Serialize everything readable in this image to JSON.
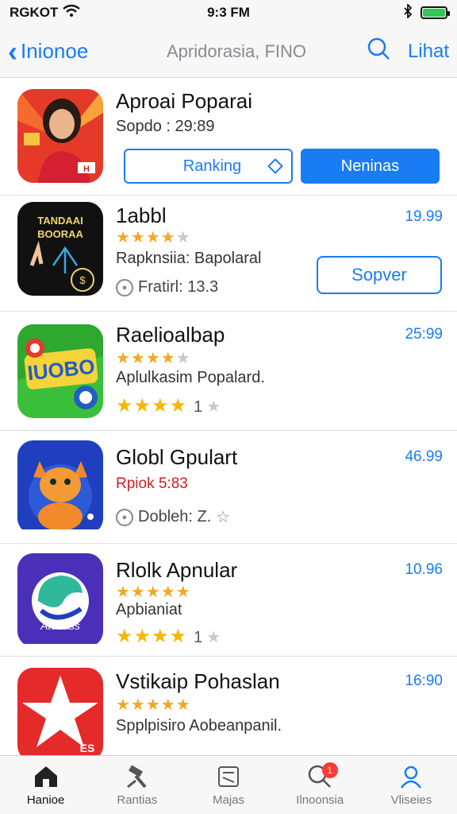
{
  "status_bar": {
    "carrier": "RGKOT",
    "time": "9:3 FM"
  },
  "nav": {
    "back_label": "Inionoe",
    "title": "Apridorasia, FINO",
    "right_label": "Lihat"
  },
  "featured": {
    "title": "Aproai Poparai",
    "subtitle": "Sopdo : 29:89",
    "button_ranking": "Ranking",
    "button_primary": "Neninas"
  },
  "apps": [
    {
      "title": "1abbl",
      "value": "19.99",
      "subtitle": "Rapknsiia: Bapolaral",
      "meta": "Fratirl: 13.3",
      "button": "Sopver",
      "rating": 4
    },
    {
      "title": "Raelioalbap",
      "value": "25:99",
      "subtitle": "Aplulkasim Popalard.",
      "rating": 4,
      "big_rating": 4,
      "rating_count": "1"
    },
    {
      "title": "Globl Gpulart",
      "value": "46.99",
      "subtitle": "Rpiok 5:83",
      "meta": "Dobleh: Z."
    },
    {
      "title": "Rlolk Apnular",
      "value": "10.96",
      "subtitle": "Apbianiat",
      "rating": 5,
      "big_rating": 4,
      "rating_count": "1"
    },
    {
      "title": "Vstikaip Pohaslan",
      "value": "16:90",
      "subtitle": "Spplpisiro Aobeanpanil.",
      "rating": 5
    }
  ],
  "tabs": [
    {
      "label": "Hanioe",
      "icon": "home-icon"
    },
    {
      "label": "Rantias",
      "icon": "hammer-icon"
    },
    {
      "label": "Majas",
      "icon": "note-icon"
    },
    {
      "label": "Ilnoonsia",
      "icon": "search-icon",
      "badge": "1"
    },
    {
      "label": "Vliseies",
      "icon": "person-icon"
    }
  ],
  "colors": {
    "accent": "#1a7cf5",
    "star": "#f5a623",
    "badge": "#ff3b30",
    "battery": "#34c759"
  }
}
